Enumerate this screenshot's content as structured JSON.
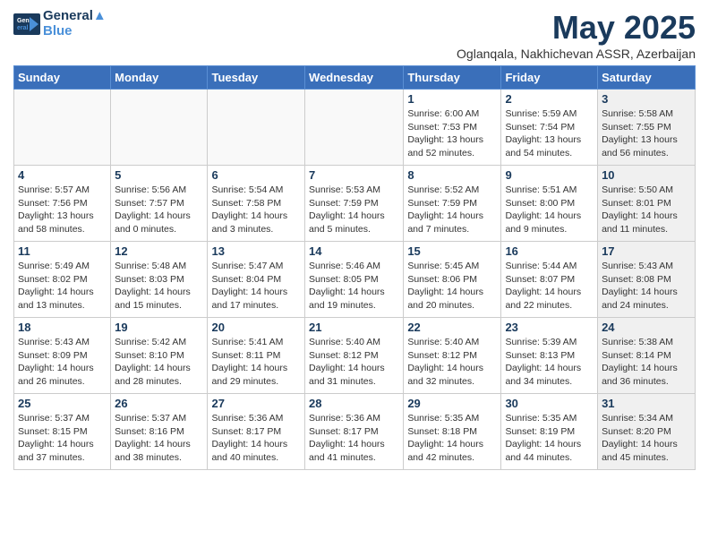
{
  "header": {
    "logo_line1": "General",
    "logo_line2": "Blue",
    "month_title": "May 2025",
    "location": "Oglanqala, Nakhichevan ASSR, Azerbaijan"
  },
  "weekdays": [
    "Sunday",
    "Monday",
    "Tuesday",
    "Wednesday",
    "Thursday",
    "Friday",
    "Saturday"
  ],
  "weeks": [
    [
      {
        "day": "",
        "detail": "",
        "empty": true
      },
      {
        "day": "",
        "detail": "",
        "empty": true
      },
      {
        "day": "",
        "detail": "",
        "empty": true
      },
      {
        "day": "",
        "detail": "",
        "empty": true
      },
      {
        "day": "1",
        "detail": "Sunrise: 6:00 AM\nSunset: 7:53 PM\nDaylight: 13 hours\nand 52 minutes."
      },
      {
        "day": "2",
        "detail": "Sunrise: 5:59 AM\nSunset: 7:54 PM\nDaylight: 13 hours\nand 54 minutes."
      },
      {
        "day": "3",
        "detail": "Sunrise: 5:58 AM\nSunset: 7:55 PM\nDaylight: 13 hours\nand 56 minutes.",
        "shaded": true
      }
    ],
    [
      {
        "day": "4",
        "detail": "Sunrise: 5:57 AM\nSunset: 7:56 PM\nDaylight: 13 hours\nand 58 minutes."
      },
      {
        "day": "5",
        "detail": "Sunrise: 5:56 AM\nSunset: 7:57 PM\nDaylight: 14 hours\nand 0 minutes."
      },
      {
        "day": "6",
        "detail": "Sunrise: 5:54 AM\nSunset: 7:58 PM\nDaylight: 14 hours\nand 3 minutes."
      },
      {
        "day": "7",
        "detail": "Sunrise: 5:53 AM\nSunset: 7:59 PM\nDaylight: 14 hours\nand 5 minutes."
      },
      {
        "day": "8",
        "detail": "Sunrise: 5:52 AM\nSunset: 7:59 PM\nDaylight: 14 hours\nand 7 minutes."
      },
      {
        "day": "9",
        "detail": "Sunrise: 5:51 AM\nSunset: 8:00 PM\nDaylight: 14 hours\nand 9 minutes."
      },
      {
        "day": "10",
        "detail": "Sunrise: 5:50 AM\nSunset: 8:01 PM\nDaylight: 14 hours\nand 11 minutes.",
        "shaded": true
      }
    ],
    [
      {
        "day": "11",
        "detail": "Sunrise: 5:49 AM\nSunset: 8:02 PM\nDaylight: 14 hours\nand 13 minutes."
      },
      {
        "day": "12",
        "detail": "Sunrise: 5:48 AM\nSunset: 8:03 PM\nDaylight: 14 hours\nand 15 minutes."
      },
      {
        "day": "13",
        "detail": "Sunrise: 5:47 AM\nSunset: 8:04 PM\nDaylight: 14 hours\nand 17 minutes."
      },
      {
        "day": "14",
        "detail": "Sunrise: 5:46 AM\nSunset: 8:05 PM\nDaylight: 14 hours\nand 19 minutes."
      },
      {
        "day": "15",
        "detail": "Sunrise: 5:45 AM\nSunset: 8:06 PM\nDaylight: 14 hours\nand 20 minutes."
      },
      {
        "day": "16",
        "detail": "Sunrise: 5:44 AM\nSunset: 8:07 PM\nDaylight: 14 hours\nand 22 minutes."
      },
      {
        "day": "17",
        "detail": "Sunrise: 5:43 AM\nSunset: 8:08 PM\nDaylight: 14 hours\nand 24 minutes.",
        "shaded": true
      }
    ],
    [
      {
        "day": "18",
        "detail": "Sunrise: 5:43 AM\nSunset: 8:09 PM\nDaylight: 14 hours\nand 26 minutes."
      },
      {
        "day": "19",
        "detail": "Sunrise: 5:42 AM\nSunset: 8:10 PM\nDaylight: 14 hours\nand 28 minutes."
      },
      {
        "day": "20",
        "detail": "Sunrise: 5:41 AM\nSunset: 8:11 PM\nDaylight: 14 hours\nand 29 minutes."
      },
      {
        "day": "21",
        "detail": "Sunrise: 5:40 AM\nSunset: 8:12 PM\nDaylight: 14 hours\nand 31 minutes."
      },
      {
        "day": "22",
        "detail": "Sunrise: 5:40 AM\nSunset: 8:12 PM\nDaylight: 14 hours\nand 32 minutes."
      },
      {
        "day": "23",
        "detail": "Sunrise: 5:39 AM\nSunset: 8:13 PM\nDaylight: 14 hours\nand 34 minutes."
      },
      {
        "day": "24",
        "detail": "Sunrise: 5:38 AM\nSunset: 8:14 PM\nDaylight: 14 hours\nand 36 minutes.",
        "shaded": true
      }
    ],
    [
      {
        "day": "25",
        "detail": "Sunrise: 5:37 AM\nSunset: 8:15 PM\nDaylight: 14 hours\nand 37 minutes."
      },
      {
        "day": "26",
        "detail": "Sunrise: 5:37 AM\nSunset: 8:16 PM\nDaylight: 14 hours\nand 38 minutes."
      },
      {
        "day": "27",
        "detail": "Sunrise: 5:36 AM\nSunset: 8:17 PM\nDaylight: 14 hours\nand 40 minutes."
      },
      {
        "day": "28",
        "detail": "Sunrise: 5:36 AM\nSunset: 8:17 PM\nDaylight: 14 hours\nand 41 minutes."
      },
      {
        "day": "29",
        "detail": "Sunrise: 5:35 AM\nSunset: 8:18 PM\nDaylight: 14 hours\nand 42 minutes."
      },
      {
        "day": "30",
        "detail": "Sunrise: 5:35 AM\nSunset: 8:19 PM\nDaylight: 14 hours\nand 44 minutes."
      },
      {
        "day": "31",
        "detail": "Sunrise: 5:34 AM\nSunset: 8:20 PM\nDaylight: 14 hours\nand 45 minutes.",
        "shaded": true
      }
    ]
  ]
}
